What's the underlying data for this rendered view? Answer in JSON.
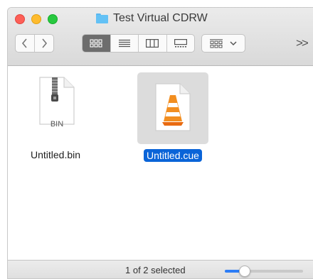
{
  "window": {
    "title": "Test Virtual CDRW",
    "toolbar": {
      "overflow_label": ">>",
      "view_modes": [
        "icon-view",
        "list-view",
        "column-view",
        "gallery-view"
      ],
      "active_view": "icon-view"
    }
  },
  "files": [
    {
      "name": "Untitled.bin",
      "type_label": "BIN",
      "icon": "zip-document-icon",
      "selected": false
    },
    {
      "name": "Untitled.cue",
      "icon": "vlc-cone-icon",
      "selected": true
    }
  ],
  "status": {
    "text": "1 of 2 selected",
    "icon_size_level": 0.25
  },
  "colors": {
    "selection": "#0a64d8",
    "slider_fill": "#2d7df6",
    "folder": "#63c1f5"
  }
}
